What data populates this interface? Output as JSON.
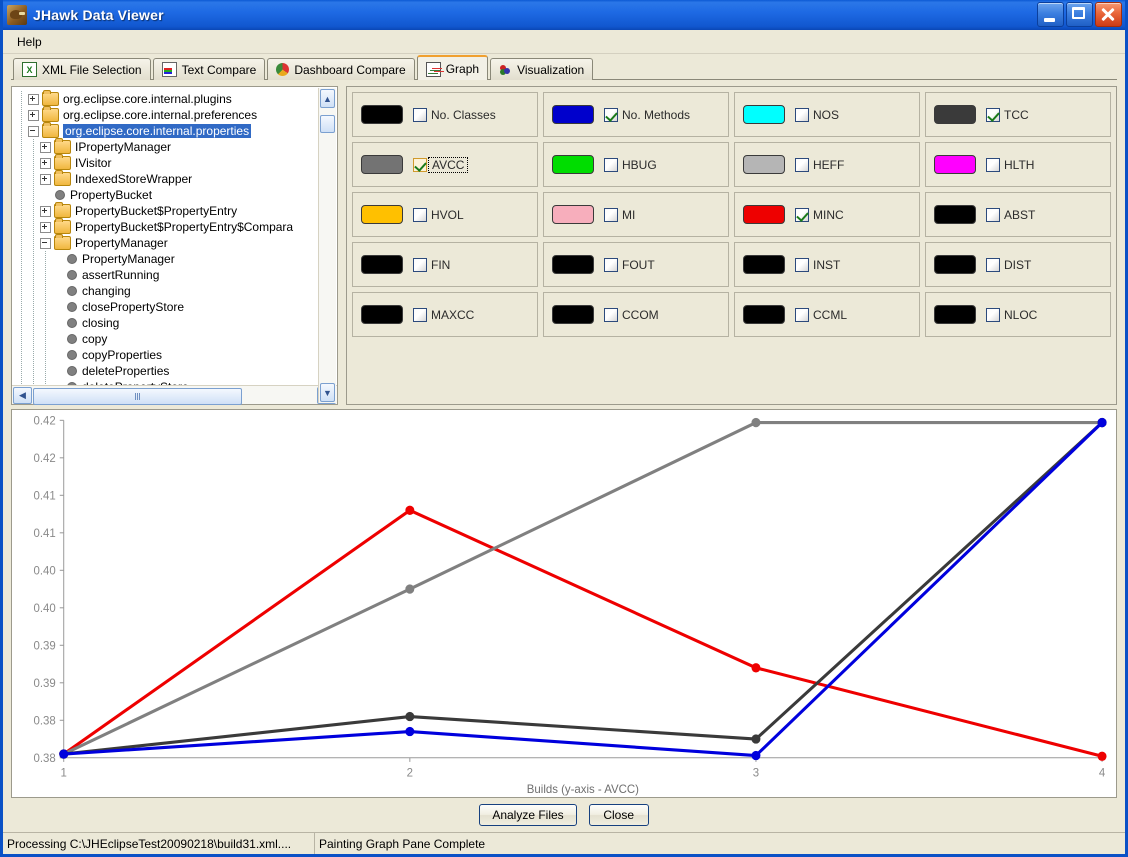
{
  "window": {
    "title": "JHawk Data Viewer",
    "icon": "hawk-icon",
    "controls": {
      "minimize": "minimize-button",
      "maximize": "maximize-button",
      "close": "close-button"
    }
  },
  "menubar": {
    "items": [
      {
        "label": "Help"
      }
    ]
  },
  "tabs": [
    {
      "label": "XML File Selection",
      "icon": "xml-file-icon",
      "active": false
    },
    {
      "label": "Text Compare",
      "icon": "text-compare-icon",
      "active": false
    },
    {
      "label": "Dashboard Compare",
      "icon": "pie-chart-icon",
      "active": false
    },
    {
      "label": "Graph",
      "icon": "graph-icon",
      "active": true
    },
    {
      "label": "Visualization",
      "icon": "visualization-icon",
      "active": false
    }
  ],
  "tree": {
    "nodes": [
      {
        "label": "org.eclipse.core.internal.plugins",
        "indent": 1,
        "toggle": "plus",
        "icon": "folder",
        "selected": false
      },
      {
        "label": "org.eclipse.core.internal.preferences",
        "indent": 1,
        "toggle": "plus",
        "icon": "folder",
        "selected": false
      },
      {
        "label": "org.eclipse.core.internal.properties",
        "indent": 1,
        "toggle": "minus",
        "icon": "folder",
        "selected": true
      },
      {
        "label": "IPropertyManager",
        "indent": 2,
        "toggle": "plus",
        "icon": "folder",
        "selected": false
      },
      {
        "label": "IVisitor",
        "indent": 2,
        "toggle": "plus",
        "icon": "folder",
        "selected": false
      },
      {
        "label": "IndexedStoreWrapper",
        "indent": 2,
        "toggle": "plus",
        "icon": "folder",
        "selected": false
      },
      {
        "label": "PropertyBucket",
        "indent": 2,
        "toggle": "none",
        "icon": "bullet",
        "selected": false
      },
      {
        "label": "PropertyBucket$PropertyEntry",
        "indent": 2,
        "toggle": "plus",
        "icon": "folder",
        "selected": false
      },
      {
        "label": "PropertyBucket$PropertyEntry$Compara",
        "indent": 2,
        "toggle": "plus",
        "icon": "folder",
        "selected": false
      },
      {
        "label": "PropertyManager",
        "indent": 2,
        "toggle": "minus",
        "icon": "folder",
        "selected": false
      },
      {
        "label": "PropertyManager",
        "indent": 3,
        "toggle": "none",
        "icon": "bullet",
        "selected": false
      },
      {
        "label": "assertRunning",
        "indent": 3,
        "toggle": "none",
        "icon": "bullet",
        "selected": false
      },
      {
        "label": "changing",
        "indent": 3,
        "toggle": "none",
        "icon": "bullet",
        "selected": false
      },
      {
        "label": "closePropertyStore",
        "indent": 3,
        "toggle": "none",
        "icon": "bullet",
        "selected": false
      },
      {
        "label": "closing",
        "indent": 3,
        "toggle": "none",
        "icon": "bullet",
        "selected": false
      },
      {
        "label": "copy",
        "indent": 3,
        "toggle": "none",
        "icon": "bullet",
        "selected": false
      },
      {
        "label": "copyProperties",
        "indent": 3,
        "toggle": "none",
        "icon": "bullet",
        "selected": false
      },
      {
        "label": "deleteProperties",
        "indent": 3,
        "toggle": "none",
        "icon": "bullet",
        "selected": false
      },
      {
        "label": "deletePropertyStore",
        "indent": 3,
        "toggle": "none",
        "icon": "bullet",
        "selected": false
      }
    ],
    "scrollbar_up": "▲",
    "scrollbar_down": "▼",
    "scrollbar_left": "◀",
    "scrollbar_right": "▶"
  },
  "metrics": [
    {
      "label": "No. Classes",
      "color": "#000000",
      "checked": false,
      "focused": false
    },
    {
      "label": "No. Methods",
      "color": "#0000cc",
      "checked": true,
      "focused": false
    },
    {
      "label": "NOS",
      "color": "#00ffff",
      "checked": false,
      "focused": false
    },
    {
      "label": "TCC",
      "color": "#3a3a3a",
      "checked": true,
      "focused": false
    },
    {
      "label": "AVCC",
      "color": "#737373",
      "checked": true,
      "focused": true
    },
    {
      "label": "HBUG",
      "color": "#00dd00",
      "checked": false,
      "focused": false
    },
    {
      "label": "HEFF",
      "color": "#b5b5b5",
      "checked": false,
      "focused": false
    },
    {
      "label": "HLTH",
      "color": "#ff00ff",
      "checked": false,
      "focused": false
    },
    {
      "label": "HVOL",
      "color": "#ffc000",
      "checked": false,
      "focused": false
    },
    {
      "label": "MI",
      "color": "#f7aebc",
      "checked": false,
      "focused": false
    },
    {
      "label": "MINC",
      "color": "#ee0000",
      "checked": true,
      "focused": false
    },
    {
      "label": "ABST",
      "color": "#000000",
      "checked": false,
      "focused": false
    },
    {
      "label": "FIN",
      "color": "#000000",
      "checked": false,
      "focused": false
    },
    {
      "label": "FOUT",
      "color": "#000000",
      "checked": false,
      "focused": false
    },
    {
      "label": "INST",
      "color": "#000000",
      "checked": false,
      "focused": false
    },
    {
      "label": "DIST",
      "color": "#000000",
      "checked": false,
      "focused": false
    },
    {
      "label": "MAXCC",
      "color": "#000000",
      "checked": false,
      "focused": false
    },
    {
      "label": "CCOM",
      "color": "#000000",
      "checked": false,
      "focused": false
    },
    {
      "label": "CCML",
      "color": "#000000",
      "checked": false,
      "focused": false
    },
    {
      "label": "NLOC",
      "color": "#000000",
      "checked": false,
      "focused": false
    }
  ],
  "chart_data": {
    "type": "line",
    "title": "",
    "xlabel": "Builds (y-axis - AVCC)",
    "ylabel": "",
    "x": [
      1,
      2,
      3,
      4
    ],
    "xticklabels": [
      "1",
      "2",
      "3",
      "4"
    ],
    "yticklabels": [
      "0.42",
      "0.42",
      "0.41",
      "0.41",
      "0.40",
      "0.40",
      "0.39",
      "0.39",
      "0.38",
      "0.38"
    ],
    "ytickvalues": [
      0.4225,
      0.4175,
      0.4125,
      0.4075,
      0.4025,
      0.3975,
      0.3925,
      0.3875,
      0.3825,
      0.3775
    ],
    "ylim": [
      0.3775,
      0.4225
    ],
    "grid": false,
    "legend": "none",
    "series": [
      {
        "name": "MINC",
        "color": "#ee0000",
        "values": [
          0.378,
          0.4105,
          0.3895,
          0.3777
        ]
      },
      {
        "name": "AVCC",
        "color": "#808080",
        "values": [
          0.378,
          0.4,
          0.4222,
          0.4222
        ]
      },
      {
        "name": "TCC",
        "color": "#3a3a3a",
        "values": [
          0.378,
          0.383,
          0.38,
          0.4222
        ]
      },
      {
        "name": "No. Methods",
        "color": "#0000dd",
        "values": [
          0.378,
          0.381,
          0.3778,
          0.4222
        ]
      }
    ]
  },
  "buttons": {
    "analyze": "Analyze Files",
    "close": "Close"
  },
  "statusbar": {
    "left": "Processing C:\\JHEclipseTest20090218\\build31.xml....",
    "right": "Painting Graph Pane Complete"
  }
}
